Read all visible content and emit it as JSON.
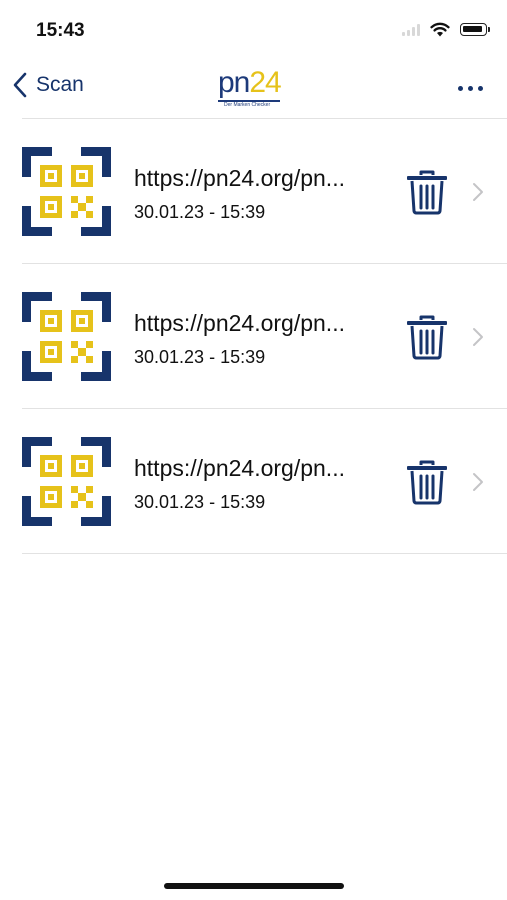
{
  "status_bar": {
    "time": "15:43"
  },
  "nav": {
    "back_label": "Scan",
    "logo": {
      "text_pn": "pn",
      "text_num": "24",
      "subtitle": "Der Marken Checker"
    }
  },
  "colors": {
    "navy": "#17346b",
    "gold": "#e6c21a",
    "divider": "#e2e2e2"
  },
  "items": [
    {
      "url": "https://pn24.org/pn...",
      "date": "30.01.23 - 15:39"
    },
    {
      "url": "https://pn24.org/pn...",
      "date": "30.01.23 - 15:39"
    },
    {
      "url": "https://pn24.org/pn...",
      "date": "30.01.23 - 15:39"
    }
  ],
  "icons": {
    "back": "chevron-left-icon",
    "more": "more-horizontal-icon",
    "qr": "qr-code-icon",
    "trash": "trash-icon",
    "chevron": "chevron-right-icon"
  }
}
